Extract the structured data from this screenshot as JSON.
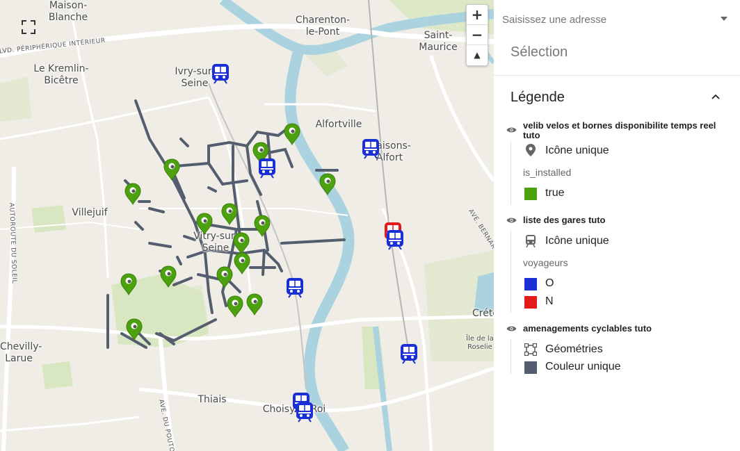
{
  "map": {
    "places": [
      {
        "text": "Maison-\nBlanche"
      },
      {
        "text": "Charenton-\nle-Pont"
      },
      {
        "text": "Saint-\nMaurice"
      },
      {
        "text": "Le Kremlin-\nBicêtre"
      },
      {
        "text": "Ivry-sur-\nSeine"
      },
      {
        "text": "Alfortville"
      },
      {
        "text": "Maisons-\nAlfort"
      },
      {
        "text": "Villejuif"
      },
      {
        "text": "Vitry-sur-\nSeine"
      },
      {
        "text": "Chevilly-\nLarue"
      },
      {
        "text": "Thiais"
      },
      {
        "text": "Choisy-le-Roi"
      },
      {
        "text": "Créte"
      },
      {
        "text": "Île de la\nRoselie"
      }
    ],
    "road_labels": [
      {
        "text": "BLVD. PÉRIPHÉRIQUE INTÉRIEUR"
      },
      {
        "text": "AUTOROUTE DU SOLEIL"
      },
      {
        "text": "AVE. DU POUTO"
      },
      {
        "text": "AVE. BERNAR"
      }
    ],
    "zoom_in": "+",
    "zoom_out": "−",
    "compass": "▲",
    "colors": {
      "velib": "#4ca10e",
      "station_O": "#1a2fd4",
      "station_N": "#e31b1b",
      "cycle": "#555e6e",
      "water": "#aad3df",
      "park": "#d8e6c1"
    }
  },
  "panel": {
    "address_placeholder": "Saisissez une adresse",
    "selection": "Sélection",
    "legend_title": "Légende",
    "layers": [
      {
        "title": "velib velos et bornes disponibilite temps reel tuto",
        "symbol": "Icône unique",
        "symbol_icon": "map-marker-icon",
        "attribute": "is_installed",
        "classes": [
          {
            "label": "true",
            "color": "#4ca10e"
          }
        ]
      },
      {
        "title": "liste des gares tuto",
        "symbol": "Icône unique",
        "symbol_icon": "train-icon",
        "attribute": "voyageurs",
        "classes": [
          {
            "label": "O",
            "color": "#1a2fd4"
          },
          {
            "label": "N",
            "color": "#e31b1b"
          }
        ]
      },
      {
        "title": "amenagements cyclables tuto",
        "symbol": "Géométries",
        "symbol_icon": "geometry-icon",
        "color_label": "Couleur unique",
        "color": "#555e6e"
      }
    ]
  }
}
